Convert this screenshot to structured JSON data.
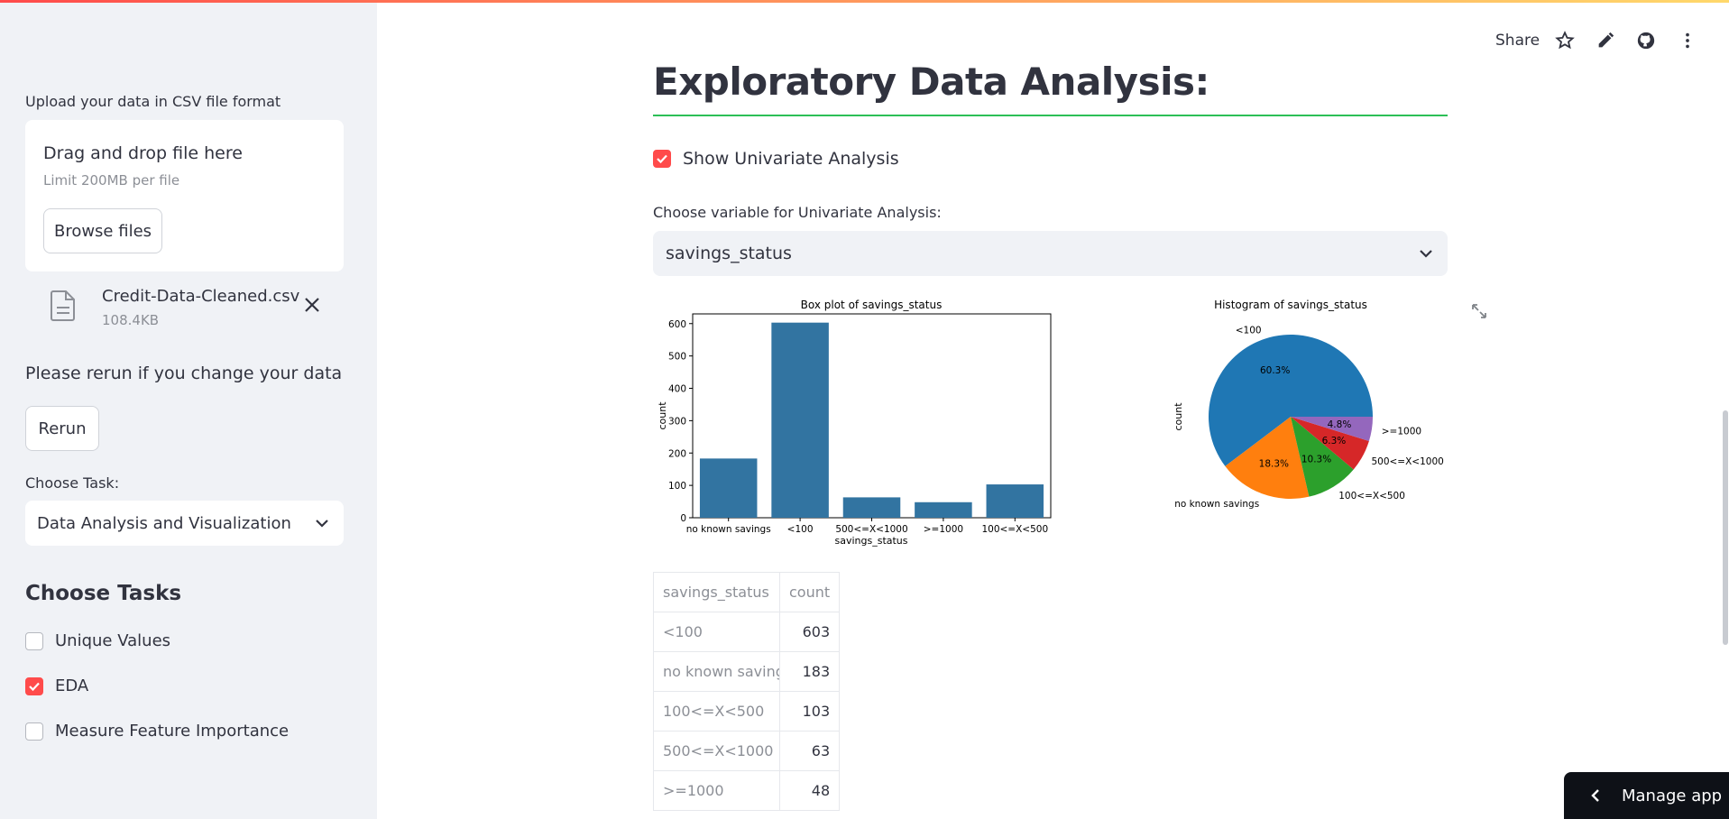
{
  "sidebar": {
    "upload_label": "Upload your data in CSV file format",
    "dropzone_title": "Drag and drop file here",
    "dropzone_limit": "Limit 200MB per file",
    "browse_button": "Browse files",
    "file_name": "Credit-Data-Cleaned.csv",
    "file_size": "108.4KB",
    "rerun_note": "Please rerun if you change your data",
    "rerun_button": "Rerun",
    "task_label": "Choose Task:",
    "task_value": "Data Analysis and Visualization",
    "tasks_heading": "Choose Tasks",
    "task_options": [
      {
        "label": "Unique Values",
        "checked": false
      },
      {
        "label": "EDA",
        "checked": true
      },
      {
        "label": "Measure Feature Importance",
        "checked": false
      }
    ]
  },
  "toolbar": {
    "share": "Share",
    "icons": [
      "star-icon",
      "edit-icon",
      "github-icon",
      "more-icon"
    ]
  },
  "main": {
    "title": "Exploratory Data Analysis:",
    "univariate_checkbox": "Show Univariate Analysis",
    "univariate_checked": true,
    "variable_label": "Choose variable for Univariate Analysis:",
    "variable_value": "savings_status"
  },
  "chart_data": [
    {
      "type": "bar",
      "title": "Box plot of savings_status",
      "xlabel": "savings_status",
      "ylabel": "count",
      "categories": [
        "no known savings",
        "<100",
        "500<=X<1000",
        ">=1000",
        "100<=X<500"
      ],
      "values": [
        183,
        603,
        63,
        48,
        103
      ],
      "ylim": [
        0,
        630
      ],
      "yticks": [
        0,
        100,
        200,
        300,
        400,
        500,
        600
      ],
      "color": "#3274a1"
    },
    {
      "type": "pie",
      "title": "Histogram of savings_status",
      "ylabel": "count",
      "labels": [
        "<100",
        "no known savings",
        "100<=X<500",
        "500<=X<1000",
        ">=1000"
      ],
      "values": [
        603,
        183,
        103,
        63,
        48
      ],
      "percent_labels": [
        "60.3%",
        "18.3%",
        "10.3%",
        "6.3%",
        "4.8%"
      ],
      "colors": [
        "#1f77b4",
        "#ff7f0e",
        "#2ca02c",
        "#d62728",
        "#9467bd"
      ]
    }
  ],
  "table": {
    "headers": [
      "savings_status",
      "count"
    ],
    "rows": [
      [
        "<100",
        "603"
      ],
      [
        "no known savings",
        "183"
      ],
      [
        "100<=X<500",
        "103"
      ],
      [
        "500<=X<1000",
        "63"
      ],
      [
        ">=1000",
        "48"
      ]
    ]
  },
  "manage_app": "Manage app",
  "colors": {
    "accent": "#ff4b4b",
    "rule": "#2dbf57",
    "sidebar_bg": "#f0f2f6",
    "text": "#31333f"
  }
}
